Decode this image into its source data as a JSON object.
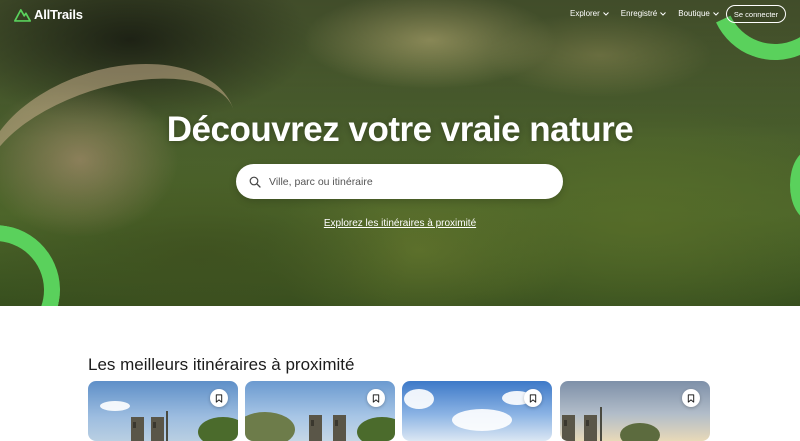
{
  "brand": {
    "name": "AllTrails",
    "accent": "#5ad15c"
  },
  "nav": {
    "items": [
      {
        "label": "Explorer"
      },
      {
        "label": "Enregistré"
      },
      {
        "label": "Boutique"
      }
    ],
    "login_label": "Se connecter"
  },
  "hero": {
    "title": "Découvrez votre vraie nature",
    "search_placeholder": "Ville, parc ou itinéraire",
    "explore_link": "Explorez les itinéraires à proximité"
  },
  "section": {
    "title": "Les meilleurs itinéraires à proximité"
  },
  "cards": [
    {
      "icon": "bookmark-icon"
    },
    {
      "icon": "bookmark-icon"
    },
    {
      "icon": "bookmark-icon"
    },
    {
      "icon": "bookmark-icon"
    }
  ]
}
